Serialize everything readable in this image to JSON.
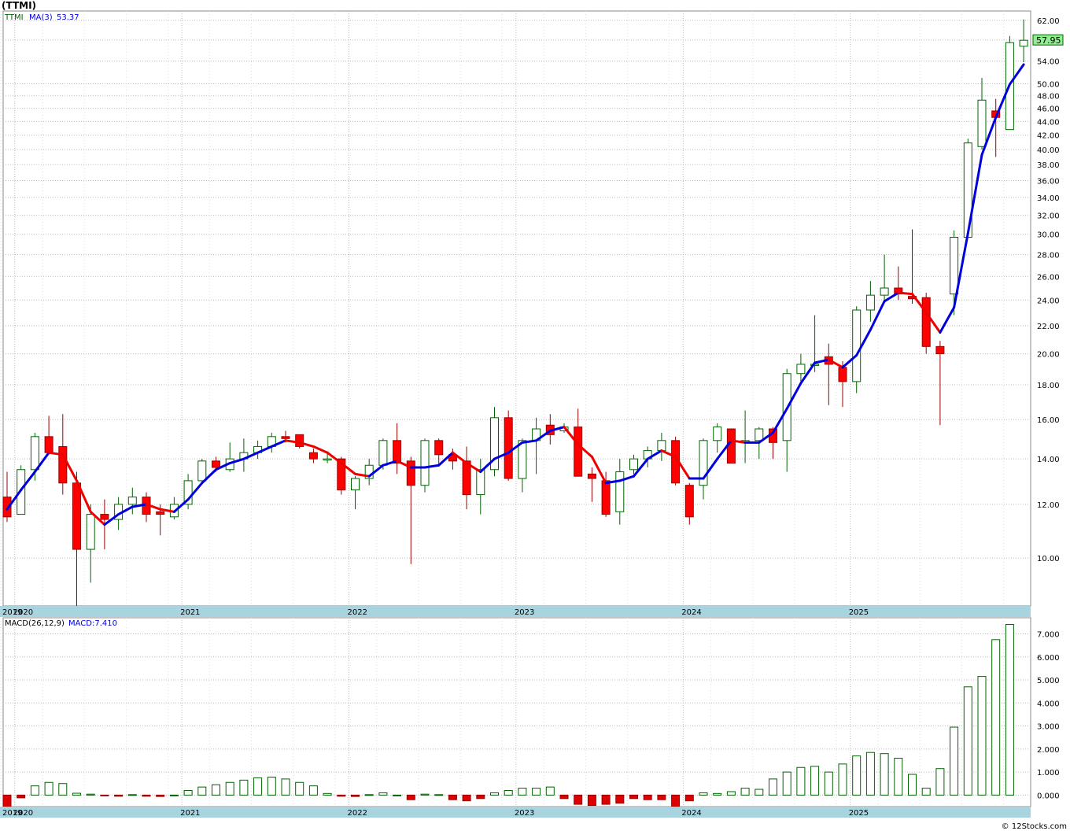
{
  "title": "(TTMI)",
  "credit": "© 12Stocks.com",
  "price_panel": {
    "symbol": "TTMI",
    "ma_label": "MA(3)",
    "ma_value": "53.37",
    "last_price_label": "57.95",
    "y_ticks": [
      10,
      12,
      14,
      16,
      18,
      20,
      22,
      24,
      26,
      28,
      30,
      32,
      34,
      36,
      38,
      40,
      42,
      44,
      46,
      48,
      50,
      54,
      58,
      62
    ],
    "y_tick_labels": [
      "10.00",
      "12.00",
      "14.00",
      "16.00",
      "18.00",
      "20.00",
      "22.00",
      "24.00",
      "26.00",
      "28.00",
      "30.00",
      "32.00",
      "34.00",
      "36.00",
      "38.00",
      "40.00",
      "42.00",
      "44.00",
      "46.00",
      "48.00",
      "50.00",
      "54.00",
      "58.00",
      "62.00"
    ]
  },
  "macd_panel": {
    "label": "MACD(26,12,9)",
    "value_label": "MACD:7.410",
    "y_ticks": [
      0,
      1,
      2,
      3,
      4,
      5,
      6,
      7
    ],
    "y_tick_labels": [
      "0.000",
      "1.000",
      "2.000",
      "3.000",
      "4.000",
      "5.000",
      "6.000",
      "7.000"
    ]
  },
  "x_axis": {
    "year_labels": [
      "2019",
      "2020",
      "2021",
      "2022",
      "2023",
      "2024",
      "2025"
    ]
  },
  "colors": {
    "up_candle_stroke": "#006400",
    "down_candle_fill": "#ff0000",
    "ma_up": "#0000dd",
    "ma_down": "#ee0000",
    "axis_band": "#a8d4e0",
    "grid": "#bbbbbb",
    "macd_pos": "#006400",
    "macd_neg": "#dd0000",
    "last_price_bg": "#90ee90"
  },
  "chart_data": [
    {
      "type": "candlestick",
      "title": "(TTMI)",
      "interval": "monthly",
      "y_scale": "log",
      "ylim": [
        8.5,
        64
      ],
      "start": "2019-12",
      "ohlc": [
        [
          12.3,
          13.4,
          11.3,
          11.5
        ],
        [
          11.6,
          13.7,
          11.6,
          13.5
        ],
        [
          13.5,
          15.3,
          13.0,
          15.1
        ],
        [
          15.1,
          16.2,
          14.2,
          14.3
        ],
        [
          14.6,
          16.3,
          12.4,
          12.9
        ],
        [
          12.9,
          13.4,
          8.2,
          10.3
        ],
        [
          10.3,
          12.0,
          9.2,
          11.6
        ],
        [
          11.6,
          12.2,
          10.3,
          11.4
        ],
        [
          11.4,
          12.3,
          11.0,
          12.0
        ],
        [
          12.0,
          12.7,
          11.6,
          12.3
        ],
        [
          12.3,
          12.5,
          11.3,
          11.6
        ],
        [
          11.7,
          12.0,
          10.8,
          11.6
        ],
        [
          11.5,
          12.3,
          11.4,
          12.0
        ],
        [
          12.0,
          13.3,
          11.8,
          13.0
        ],
        [
          13.0,
          14.0,
          12.9,
          13.9
        ],
        [
          13.9,
          14.1,
          13.4,
          13.6
        ],
        [
          13.5,
          14.8,
          13.4,
          14.0
        ],
        [
          14.0,
          15.0,
          13.4,
          14.3
        ],
        [
          14.3,
          14.9,
          14.0,
          14.6
        ],
        [
          14.6,
          15.3,
          14.3,
          15.1
        ],
        [
          15.1,
          15.4,
          14.8,
          15.0
        ],
        [
          15.2,
          15.2,
          14.5,
          14.6
        ],
        [
          14.3,
          14.5,
          13.8,
          14.0
        ],
        [
          14.0,
          14.3,
          13.8,
          14.0
        ],
        [
          14.0,
          14.1,
          12.4,
          12.6
        ],
        [
          12.6,
          13.2,
          11.8,
          13.1
        ],
        [
          13.1,
          14.0,
          12.8,
          13.7
        ],
        [
          13.7,
          15.0,
          13.5,
          14.9
        ],
        [
          14.9,
          15.8,
          13.3,
          13.8
        ],
        [
          13.9,
          14.1,
          9.8,
          12.8
        ],
        [
          12.8,
          15.0,
          12.5,
          14.9
        ],
        [
          14.9,
          15.0,
          13.7,
          14.2
        ],
        [
          14.2,
          14.5,
          13.5,
          13.9
        ],
        [
          13.9,
          14.6,
          11.8,
          12.4
        ],
        [
          12.4,
          14.0,
          11.6,
          13.5
        ],
        [
          13.5,
          16.7,
          13.2,
          16.1
        ],
        [
          16.1,
          16.5,
          13.0,
          13.1
        ],
        [
          13.1,
          15.0,
          12.5,
          14.9
        ],
        [
          14.9,
          16.1,
          13.3,
          15.5
        ],
        [
          15.7,
          16.3,
          14.7,
          15.2
        ],
        [
          15.4,
          15.8,
          15.3,
          15.6
        ],
        [
          15.6,
          16.6,
          13.2,
          13.2
        ],
        [
          13.3,
          13.6,
          12.1,
          13.1
        ],
        [
          13.0,
          13.4,
          11.5,
          11.6
        ],
        [
          11.7,
          14.0,
          11.2,
          13.4
        ],
        [
          13.5,
          14.2,
          13.3,
          14.0
        ],
        [
          14.0,
          14.6,
          13.6,
          14.4
        ],
        [
          14.4,
          15.3,
          13.9,
          14.9
        ],
        [
          14.9,
          15.1,
          12.8,
          12.9
        ],
        [
          12.8,
          12.9,
          11.2,
          11.5
        ],
        [
          12.8,
          15.0,
          12.2,
          14.9
        ],
        [
          14.9,
          15.8,
          14.3,
          15.6
        ],
        [
          15.5,
          15.5,
          13.8,
          13.8
        ],
        [
          14.8,
          16.5,
          13.8,
          14.9
        ],
        [
          14.9,
          15.6,
          14.0,
          15.5
        ],
        [
          15.5,
          15.6,
          14.0,
          14.8
        ],
        [
          14.9,
          19.0,
          13.4,
          18.7
        ],
        [
          18.7,
          20.0,
          18.0,
          19.3
        ],
        [
          19.3,
          22.8,
          18.8,
          19.3
        ],
        [
          19.8,
          20.7,
          16.8,
          19.3
        ],
        [
          19.1,
          19.5,
          16.7,
          18.2
        ],
        [
          18.2,
          23.5,
          17.5,
          23.2
        ],
        [
          23.2,
          25.6,
          22.3,
          24.4
        ],
        [
          24.4,
          28.0,
          23.8,
          25.0
        ],
        [
          25.0,
          26.9,
          24.0,
          24.5
        ],
        [
          24.3,
          30.5,
          23.7,
          24.1
        ],
        [
          24.2,
          24.6,
          20.0,
          20.5
        ],
        [
          20.5,
          20.9,
          15.7,
          20.0
        ],
        [
          24.5,
          30.4,
          22.8,
          29.7
        ],
        [
          29.7,
          41.5,
          29.7,
          40.9
        ],
        [
          40.4,
          51.0,
          40.0,
          47.3
        ],
        [
          45.6,
          47.5,
          39.0,
          44.6
        ],
        [
          42.8,
          58.8,
          42.8,
          57.5
        ],
        [
          56.8,
          62.2,
          53.8,
          57.95
        ]
      ],
      "ma3": [
        11.8,
        12.6,
        13.4,
        14.3,
        14.2,
        13.0,
        11.7,
        11.2,
        11.6,
        11.9,
        12.0,
        11.8,
        11.7,
        12.2,
        12.9,
        13.5,
        13.8,
        14.0,
        14.3,
        14.6,
        14.9,
        14.8,
        14.6,
        14.3,
        13.8,
        13.3,
        13.2,
        13.7,
        13.9,
        13.6,
        13.6,
        13.7,
        14.3,
        13.8,
        13.4,
        14.0,
        14.3,
        14.8,
        14.9,
        15.4,
        15.6,
        14.7,
        14.1,
        12.9,
        13.0,
        13.2,
        14.0,
        14.4,
        14.1,
        13.1,
        13.1,
        14.0,
        14.9,
        14.8,
        14.8,
        15.3,
        16.6,
        18.1,
        19.4,
        19.6,
        19.1,
        19.9,
        21.7,
        23.9,
        24.6,
        24.5,
        23.0,
        21.5,
        23.4,
        30.1,
        39.3,
        44.6,
        49.9,
        53.37
      ]
    },
    {
      "type": "bar",
      "title": "MACD(26,12,9)",
      "ylim": [
        -0.5,
        7.7
      ],
      "start": "2019-12",
      "values": [
        -0.5,
        -0.12,
        0.4,
        0.55,
        0.5,
        0.08,
        0.04,
        -0.03,
        -0.05,
        0.02,
        -0.05,
        -0.06,
        0.0,
        0.2,
        0.35,
        0.45,
        0.55,
        0.65,
        0.75,
        0.78,
        0.7,
        0.55,
        0.4,
        0.07,
        -0.05,
        -0.06,
        0.02,
        0.1,
        0.0,
        -0.2,
        0.04,
        0.02,
        -0.2,
        -0.25,
        -0.15,
        0.1,
        0.2,
        0.3,
        0.3,
        0.35,
        -0.15,
        -0.4,
        -0.45,
        -0.4,
        -0.35,
        -0.15,
        -0.2,
        -0.2,
        -0.5,
        -0.25,
        0.1,
        0.07,
        0.15,
        0.3,
        0.25,
        0.7,
        1.0,
        1.2,
        1.25,
        1.0,
        1.35,
        1.7,
        1.85,
        1.8,
        1.6,
        0.9,
        0.3,
        1.15,
        2.95,
        4.7,
        5.15,
        6.75,
        7.41
      ]
    }
  ]
}
